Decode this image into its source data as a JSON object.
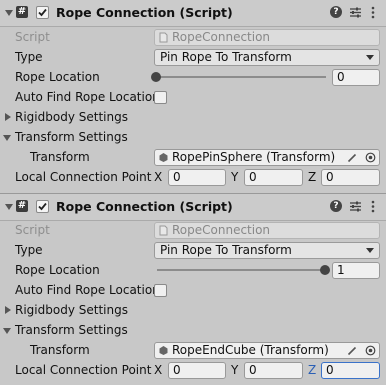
{
  "components": [
    {
      "title": "Rope Connection (Script)",
      "rows": {
        "script_label": "Script",
        "script_value": "RopeConnection",
        "type_label": "Type",
        "type_value": "Pin Rope To Transform",
        "rope_location_label": "Rope Location",
        "rope_location_value": "0",
        "rope_location_fraction": 0,
        "auto_find_label": "Auto Find Rope Locatior",
        "rigidbody_settings": "Rigidbody Settings",
        "transform_settings": "Transform Settings",
        "transform_label": "Transform",
        "transform_value": "RopePinSphere (Transform)",
        "local_connection_label": "Local Connection Point",
        "x_label": "X",
        "x_value": "0",
        "y_label": "Y",
        "y_value": "0",
        "z_label": "Z",
        "z_value": "0"
      }
    },
    {
      "title": "Rope Connection (Script)",
      "rows": {
        "script_label": "Script",
        "script_value": "RopeConnection",
        "type_label": "Type",
        "type_value": "Pin Rope To Transform",
        "rope_location_label": "Rope Location",
        "rope_location_value": "1",
        "rope_location_fraction": 1,
        "auto_find_label": "Auto Find Rope Locatior",
        "rigidbody_settings": "Rigidbody Settings",
        "transform_settings": "Transform Settings",
        "transform_label": "Transform",
        "transform_value": "RopeEndCube (Transform)",
        "local_connection_label": "Local Connection Point",
        "x_label": "X",
        "x_value": "0",
        "y_label": "Y",
        "y_value": "0",
        "z_label": "Z",
        "z_value": "0"
      }
    }
  ],
  "icons": [
    "foldout-arrow-icon",
    "script-hash-icon",
    "enabled-checkbox",
    "help-icon",
    "presets-icon",
    "kebab-menu-icon",
    "script-file-icon",
    "transform-icon",
    "eyedropper-icon",
    "object-picker-icon"
  ]
}
